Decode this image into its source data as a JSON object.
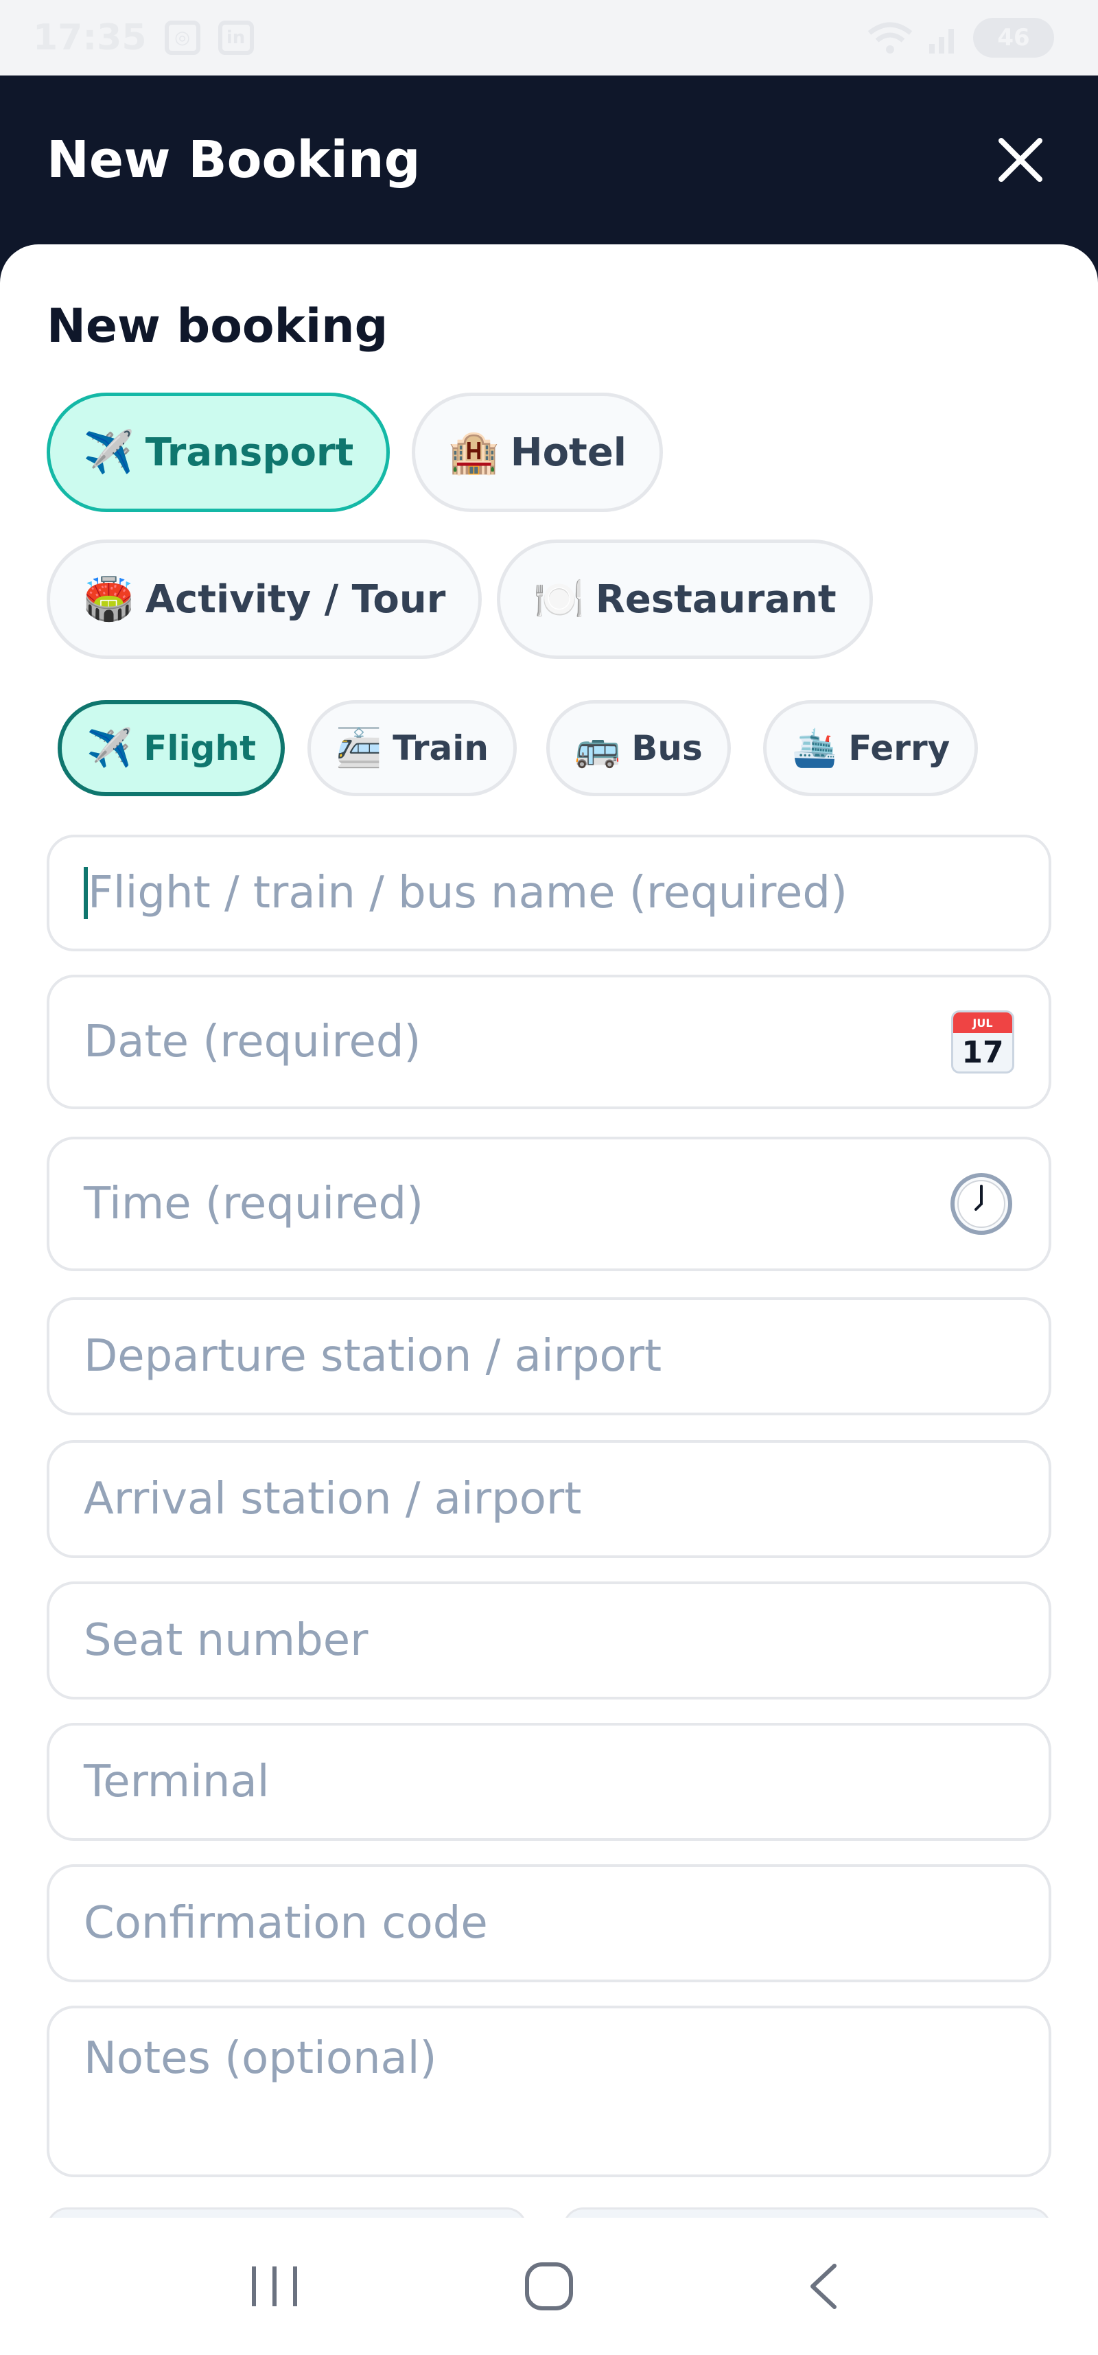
{
  "status_bar": {
    "time": "17:35",
    "battery": "46"
  },
  "header": {
    "title": "New Booking"
  },
  "section": {
    "title": "New booking"
  },
  "categories": [
    {
      "emoji": "✈️",
      "label": "Transport",
      "active": true
    },
    {
      "emoji": "🏨",
      "label": "Hotel",
      "active": false
    },
    {
      "emoji": "🏟️",
      "label": "Activity / Tour",
      "active": false
    },
    {
      "emoji": "🍽️",
      "label": "Restaurant",
      "active": false
    }
  ],
  "transport_types": [
    {
      "emoji": "✈️",
      "label": "Flight",
      "active": true
    },
    {
      "emoji": "🚈",
      "label": "Train",
      "active": false
    },
    {
      "emoji": "🚌",
      "label": "Bus",
      "active": false
    },
    {
      "emoji": "🛳️",
      "label": "Ferry",
      "active": false
    }
  ],
  "fields": {
    "name": {
      "placeholder": "Flight / train / bus name (required)",
      "value": ""
    },
    "date": {
      "placeholder": "Date (required)",
      "icon": "calendar-icon",
      "cal_month": "JUL",
      "cal_day": "17"
    },
    "time": {
      "placeholder": "Time (required)",
      "icon": "clock-icon"
    },
    "departure": {
      "placeholder": "Departure station / airport"
    },
    "arrival": {
      "placeholder": "Arrival station / airport"
    },
    "seat": {
      "placeholder": "Seat number"
    },
    "terminal": {
      "placeholder": "Terminal"
    },
    "confirmation": {
      "placeholder": "Confirmation code"
    },
    "notes": {
      "placeholder": "Notes (optional)"
    }
  },
  "colors": {
    "header_bg": "#0f172a",
    "accent": "#14b8a6",
    "accent_dark": "#0f766e",
    "active_chip_bg": "#ccfbef",
    "placeholder": "#94a3b8"
  }
}
